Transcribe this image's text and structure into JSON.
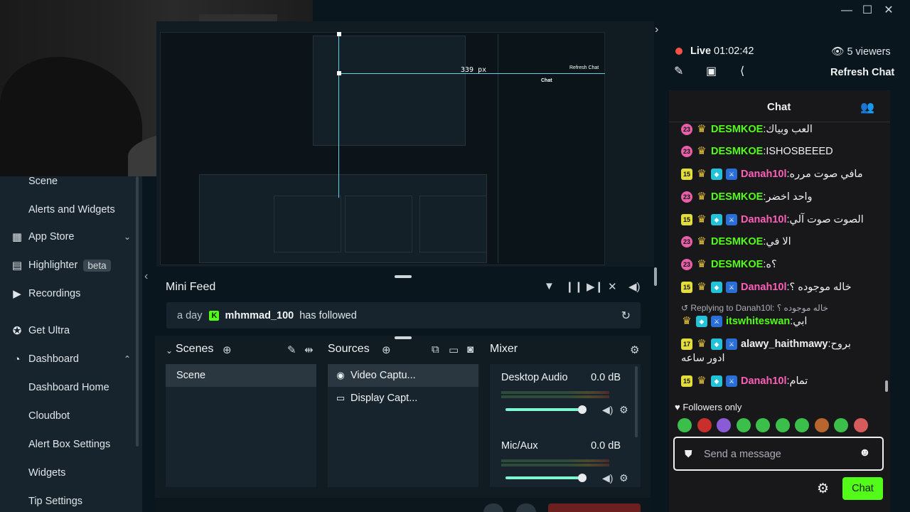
{
  "window": {
    "minimize": "—",
    "maximize": "☐",
    "close": "✕"
  },
  "leftnav": {
    "items": [
      {
        "label": "Scene",
        "icon": "",
        "sub": true
      },
      {
        "label": "Alerts and Widgets",
        "icon": "",
        "sub": true
      },
      {
        "label": "App Store",
        "icon": "store-icon",
        "glyph": "▦",
        "chevron": "⌄"
      },
      {
        "label": "Highlighter",
        "icon": "highlighter-icon",
        "glyph": "▤",
        "badge": "beta"
      },
      {
        "label": "Recordings",
        "icon": "play-icon",
        "glyph": "▶"
      },
      {
        "label": "Get Ultra",
        "icon": "ultra-icon",
        "glyph": "✪"
      },
      {
        "label": "Dashboard",
        "icon": "dashboard-icon",
        "glyph": "◔",
        "chevron": "⌃"
      },
      {
        "label": "Dashboard Home",
        "sub": true
      },
      {
        "label": "Cloudbot",
        "sub": true
      },
      {
        "label": "Alert Box Settings",
        "sub": true
      },
      {
        "label": "Widgets",
        "sub": true
      },
      {
        "label": "Tip Settings",
        "sub": true
      }
    ]
  },
  "preview": {
    "px_label": "339 px",
    "chat_label": "Chat",
    "refresh_label": "Refresh Chat"
  },
  "minifeed": {
    "title": "Mini Feed",
    "event": {
      "time": "a day",
      "platform_badge": "K",
      "user": "mhmmad_100",
      "action": "has followed"
    }
  },
  "scenes": {
    "title": "Scenes",
    "items": [
      "Scene"
    ]
  },
  "sources": {
    "title": "Sources",
    "items": [
      {
        "label": "Video Captu...",
        "icon": "webcam-icon"
      },
      {
        "label": "Display Capt...",
        "icon": "monitor-icon"
      }
    ]
  },
  "mixer": {
    "title": "Mixer",
    "channels": [
      {
        "name": "Desktop Audio",
        "db": "0.0 dB",
        "level": 1.0
      },
      {
        "name": "Mic/Aux",
        "db": "0.0 dB",
        "level": 1.0
      }
    ]
  },
  "live": {
    "status": "Live",
    "timer": "01:02:42",
    "viewers": "5 viewers",
    "refresh": "Refresh Chat"
  },
  "chat": {
    "title": "Chat",
    "messages": [
      {
        "badges": [
          "23",
          "crown"
        ],
        "user": "DESMKOE",
        "color": "#53fc18",
        "text": "العب وبياك"
      },
      {
        "badges": [
          "23",
          "crown"
        ],
        "user": "DESMKOE",
        "color": "#53fc18",
        "text": "ISHOSBEEED"
      },
      {
        "badges": [
          "15",
          "crown",
          "vip",
          "mod"
        ],
        "user": "Danah10l",
        "color": "#ff5fb8",
        "text": "مافي صوت مرره"
      },
      {
        "badges": [
          "23",
          "crown"
        ],
        "user": "DESMKOE",
        "color": "#53fc18",
        "text": "واحد اخضر"
      },
      {
        "badges": [
          "15",
          "crown",
          "vip",
          "mod"
        ],
        "user": "Danah10l",
        "color": "#ff5fb8",
        "text": "الصوت صوت آلي"
      },
      {
        "badges": [
          "23",
          "crown"
        ],
        "user": "DESMKOE",
        "color": "#53fc18",
        "text": "الا في"
      },
      {
        "badges": [
          "23",
          "crown"
        ],
        "user": "DESMKOE",
        "color": "#53fc18",
        "text": "؟ه"
      },
      {
        "badges": [
          "15",
          "crown",
          "vip",
          "mod"
        ],
        "user": "Danah10l",
        "color": "#ff5fb8",
        "text": "خاله موجوده ؟"
      },
      {
        "badges": [
          "crown",
          "vip",
          "mod"
        ],
        "user": "itswhiteswan",
        "color": "#53fc18",
        "text": "ابي"
      },
      {
        "badges": [
          "17",
          "crown",
          "vip",
          "mod"
        ],
        "user": "alawy_haithmawy",
        "color": "#efeff1",
        "text": "بروح"
      },
      {
        "badges": [
          "15",
          "crown",
          "vip",
          "mod"
        ],
        "user": "Danah10l",
        "color": "#ff5fb8",
        "text": "تمام"
      }
    ],
    "reply_hint": "↺ Replying to Danah10l: خاله موجوده ؟",
    "wrap_line": "ادور ساعه",
    "followers_only": "♥ Followers only",
    "send_placeholder": "Send a message",
    "send_button": "Chat"
  }
}
